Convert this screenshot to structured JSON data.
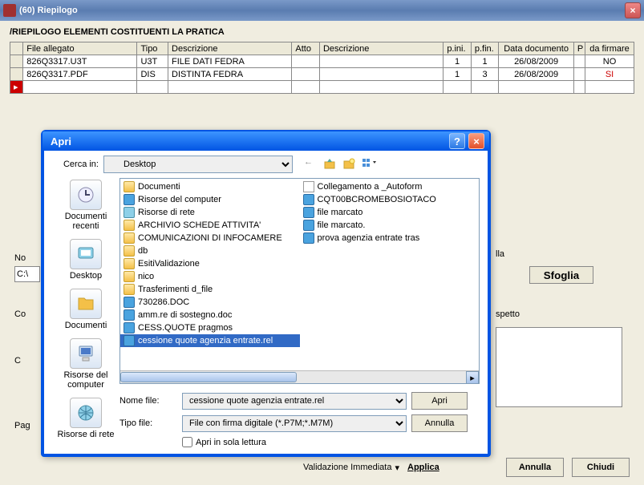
{
  "window": {
    "title": "(60) Riepilogo",
    "header": "/RIEPILOGO ELEMENTI COSTITUENTI LA PRATICA"
  },
  "table": {
    "cols": [
      "File allegato",
      "Tipo",
      "Descrizione",
      "Atto",
      "Descrizione",
      "p.ini.",
      "p.fin.",
      "Data documento",
      "P",
      "da firmare"
    ],
    "rows": [
      {
        "file": "826Q3317.U3T",
        "tipo": "U3T",
        "desc": "FILE DATI FEDRA",
        "atto": "",
        "desc2": "",
        "pini": "1",
        "pfin": "1",
        "data": "26/08/2009",
        "p": "",
        "firm": "NO",
        "firmClass": ""
      },
      {
        "file": "826Q3317.PDF",
        "tipo": "DIS",
        "desc": "DISTINTA FEDRA",
        "atto": "",
        "desc2": "",
        "pini": "1",
        "pfin": "3",
        "data": "26/08/2009",
        "p": "",
        "firm": "SI",
        "firmClass": "si"
      }
    ]
  },
  "bg": {
    "no_label": "No",
    "cw_value": "C:\\",
    "co_label": "Co",
    "c_label": "C",
    "pag_label": "Pag",
    "sfoglia": "Sfoglia",
    "lla": "lla",
    "spetto": "spetto",
    "validazione": "Validazione Immediata",
    "applica": "Applica",
    "annulla": "Annulla",
    "chiudi": "Chiudi"
  },
  "dialog": {
    "title": "Apri",
    "lookin_label": "Cerca in:",
    "lookin_value": "Desktop",
    "places": {
      "recent": "Documenti recenti",
      "desktop": "Desktop",
      "documents": "Documenti",
      "computer": "Risorse del computer",
      "network": "Risorse di rete"
    },
    "files_col1": [
      {
        "t": "folder",
        "n": "Documenti"
      },
      {
        "t": "generic",
        "n": "Risorse del computer"
      },
      {
        "t": "net",
        "n": "Risorse di rete"
      },
      {
        "t": "folder",
        "n": "ARCHIVIO SCHEDE ATTIVITA'"
      },
      {
        "t": "folder",
        "n": "COMUNICAZIONI DI INFOCAMERE"
      },
      {
        "t": "folder",
        "n": "db"
      },
      {
        "t": "folder",
        "n": "EsitiValidazione"
      },
      {
        "t": "folder",
        "n": "nico"
      },
      {
        "t": "folder",
        "n": "Trasferimenti d_file"
      },
      {
        "t": "generic",
        "n": "730286.DOC"
      },
      {
        "t": "generic",
        "n": "amm.re di sostegno.doc"
      },
      {
        "t": "generic",
        "n": "CESS.QUOTE pragmos"
      },
      {
        "t": "generic",
        "n": "cessione quote agenzia entrate.rel",
        "selected": true
      }
    ],
    "files_col2": [
      {
        "t": "link",
        "n": "Collegamento a _Autoform"
      },
      {
        "t": "generic",
        "n": "CQT00BCROMEBOSIOTACO"
      },
      {
        "t": "generic",
        "n": "file marcato"
      },
      {
        "t": "generic",
        "n": "file marcato."
      },
      {
        "t": "generic",
        "n": "prova agenzia entrate tras"
      }
    ],
    "filename_label": "Nome file:",
    "filename_value": "cessione quote agenzia entrate.rel",
    "filetype_label": "Tipo file:",
    "filetype_value": "File con firma digitale (*.P7M;*.M7M)",
    "readonly_label": "Apri in sola lettura",
    "open": "Apri",
    "cancel": "Annulla"
  }
}
